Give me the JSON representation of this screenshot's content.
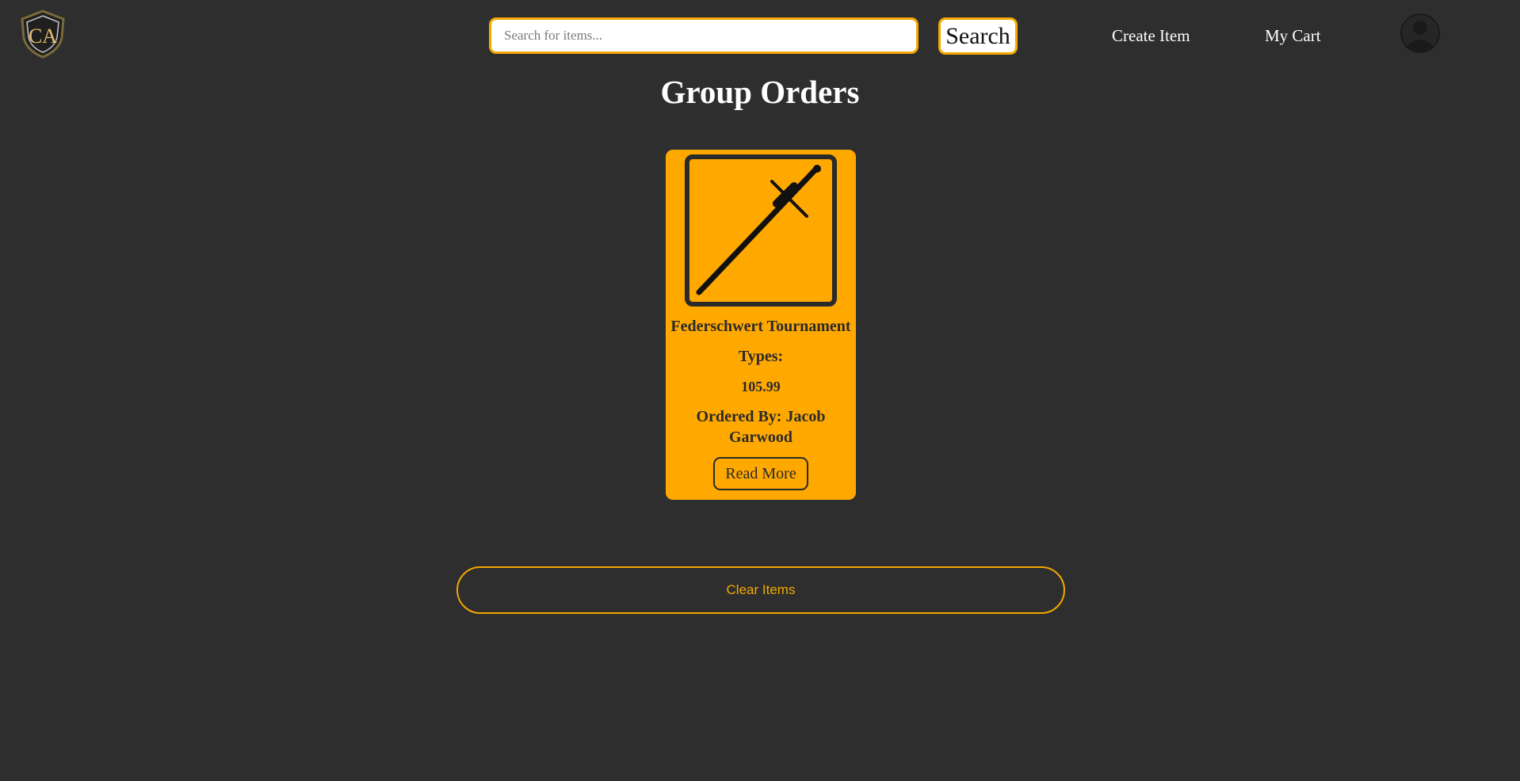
{
  "header": {
    "logo_icon": "shield-monogram-icon",
    "logo_text": "CA",
    "search": {
      "placeholder": "Search for items...",
      "value": "",
      "button_label": "Search"
    },
    "nav": {
      "create_item": "Create Item",
      "my_cart": "My Cart"
    },
    "avatar_icon": "user-avatar-icon"
  },
  "main": {
    "title": "Group Orders",
    "orders": [
      {
        "image_icon": "sword-icon",
        "name": "Federschwert Tournament",
        "types_label": "Types:",
        "price": "105.99",
        "ordered_by": "Ordered By: Jacob Garwood",
        "read_more_label": "Read More"
      }
    ],
    "clear_label": "Clear Items"
  },
  "colors": {
    "background": "#2e2e2e",
    "accent": "#f4a800",
    "card": "#ffa800",
    "card_text": "#2a2a2a"
  }
}
